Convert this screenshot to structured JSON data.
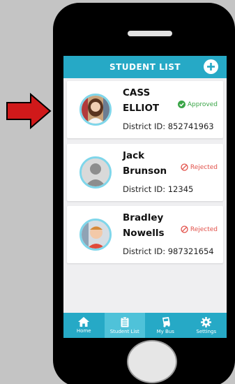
{
  "header": {
    "title": "STUDENT LIST"
  },
  "students": [
    {
      "name_line1": "CASS",
      "name_line2": "ELLIOT",
      "status": "Approved",
      "district": "District ID: 852741963"
    },
    {
      "name_line1": "Jack",
      "name_line2": "Brunson",
      "status": "Rejected",
      "district": "District ID: 12345"
    },
    {
      "name_line1": "Bradley",
      "name_line2": "Nowells",
      "status": "Rejected",
      "district": "District ID: 987321654"
    }
  ],
  "nav": [
    {
      "label": "Home",
      "icon": "home-icon"
    },
    {
      "label": "Student List",
      "icon": "clipboard-icon"
    },
    {
      "label": "My Bus",
      "icon": "bus-icon"
    },
    {
      "label": "Settings",
      "icon": "gear-icon"
    }
  ],
  "colors": {
    "accent": "#26a9c6",
    "approved": "#3aa547",
    "rejected": "#e2514a",
    "arrow": "#d0191a"
  }
}
